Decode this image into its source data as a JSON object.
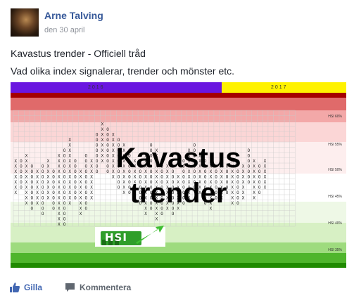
{
  "post": {
    "author": "Arne Talving",
    "date": "den 30 april",
    "title": "Kavastus trender - Officiell tråd",
    "subtitle": "Vad olika index signalerar, trender och mönster etc."
  },
  "image": {
    "top_left_year": "2016",
    "top_right_year": "2017",
    "overlay_line1": "Kavastus",
    "overlay_line2": "trender",
    "logo_text": "HSI",
    "level_labels": [
      "HSI 60%",
      "HSI 55%",
      "HSI 50%",
      "HSI 45%",
      "HSI 40%",
      "HSI 35%"
    ],
    "colors": {
      "header_left": "#6a16e0",
      "header_right": "#fff200",
      "dark_red": "#a40000",
      "dark_green": "#1f8a00"
    }
  },
  "actions": {
    "like_label": "Gilla",
    "comment_label": "Kommentera"
  }
}
